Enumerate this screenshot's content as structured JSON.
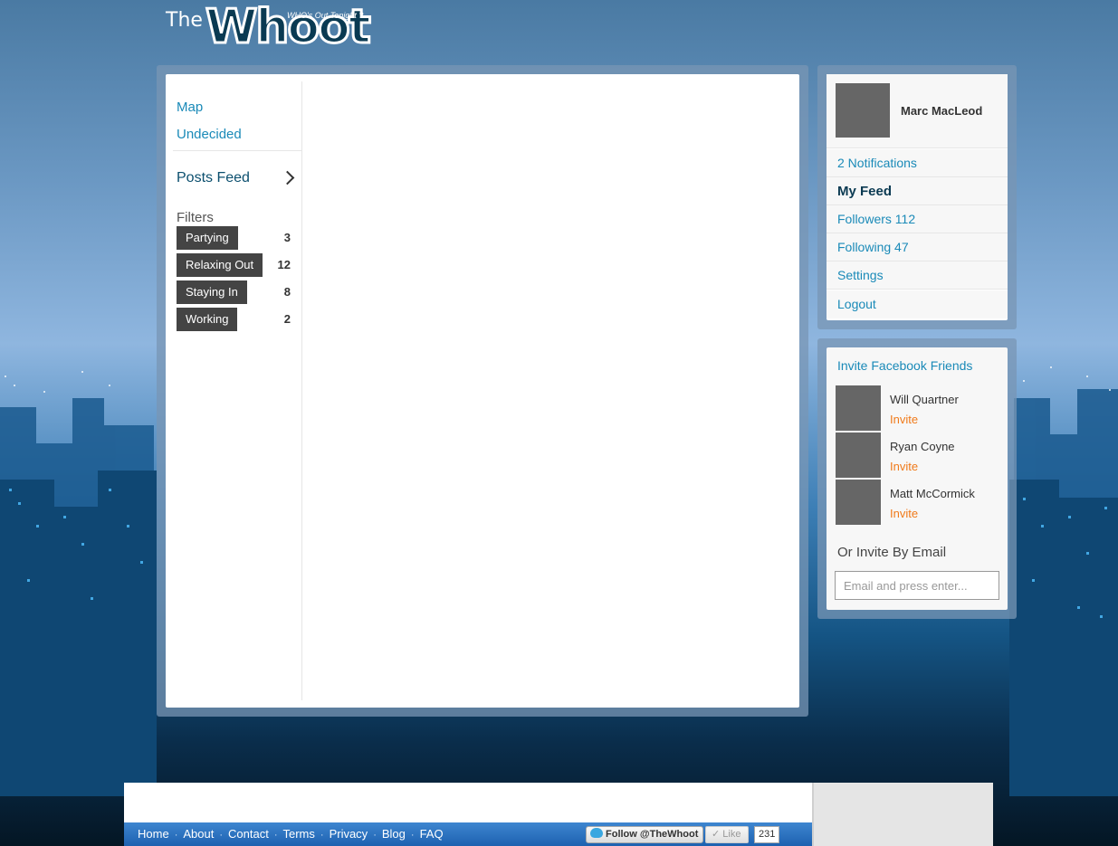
{
  "logo": {
    "prefix": "The",
    "name": "Whoot",
    "tagline": "WHO's Out Tonight ?"
  },
  "left_nav": {
    "links": [
      "Map",
      "Undecided"
    ],
    "posts_feed_label": "Posts Feed",
    "filters_title": "Filters",
    "filters": [
      {
        "label": "Partying",
        "count": "3"
      },
      {
        "label": "Relaxing Out",
        "count": "12"
      },
      {
        "label": "Staying In",
        "count": "8"
      },
      {
        "label": "Working",
        "count": "2"
      }
    ]
  },
  "profile": {
    "name": "Marc MacLeod",
    "menu": [
      {
        "label": "2 Notifications"
      },
      {
        "label": "My Feed"
      },
      {
        "label": "Followers 112"
      },
      {
        "label": "Following 47"
      },
      {
        "label": "Settings"
      },
      {
        "label": "Logout"
      }
    ]
  },
  "invite": {
    "title": "Invite Facebook Friends",
    "friends": [
      {
        "name": "Will Quartner",
        "action": "Invite"
      },
      {
        "name": "Ryan Coyne",
        "action": "Invite"
      },
      {
        "name": "Matt McCormick",
        "action": "Invite"
      }
    ],
    "email_title": "Or Invite By Email",
    "email_placeholder": "Email and press enter..."
  },
  "footer": {
    "links": [
      "Home",
      "About",
      "Contact",
      "Terms",
      "Privacy",
      "Blog",
      "FAQ"
    ],
    "separator": "·",
    "follow_label": "Follow @TheWhoot",
    "like_label": "Like",
    "like_count": "231"
  },
  "colors": {
    "link_blue": "#1a8ab8",
    "invite_orange": "#f07a1a",
    "chip_dark": "#444444",
    "footer_blue": "#1d61b0"
  }
}
